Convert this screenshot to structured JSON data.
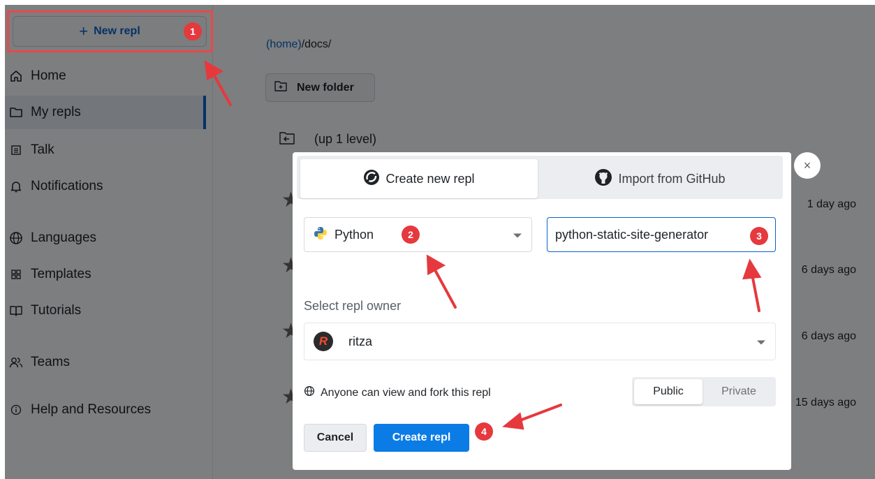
{
  "sidebar": {
    "new_repl": "New repl",
    "items": [
      {
        "label": "Home",
        "icon": "home-icon"
      },
      {
        "label": "My repls",
        "icon": "folder-icon"
      },
      {
        "label": "Talk",
        "icon": "talk-icon"
      },
      {
        "label": "Notifications",
        "icon": "bell-icon"
      },
      {
        "label": "Languages",
        "icon": "globe-icon"
      },
      {
        "label": "Templates",
        "icon": "templates-icon"
      },
      {
        "label": "Tutorials",
        "icon": "book-icon"
      },
      {
        "label": "Teams",
        "icon": "people-icon"
      },
      {
        "label": "Help and Resources",
        "icon": "info-icon"
      }
    ]
  },
  "main": {
    "breadcrumb_home": "(home)",
    "breadcrumb_path": "/docs/",
    "new_folder": "New folder",
    "up_level": "(up 1 level)",
    "rows": [
      {
        "time": "1 day ago"
      },
      {
        "time": "6 days ago"
      },
      {
        "time": "6 days ago"
      },
      {
        "time": "15 days ago"
      }
    ]
  },
  "modal": {
    "tab_create": "Create new repl",
    "tab_import": "Import from GitHub",
    "language": "Python",
    "repl_name": "python-static-site-generator",
    "owner_label": "Select repl owner",
    "owner_initial": "R",
    "owner_name": "ritza",
    "visibility_text": "Anyone can view and fork this repl",
    "public": "Public",
    "private": "Private",
    "cancel": "Cancel",
    "create": "Create repl",
    "close": "×"
  },
  "annotations": {
    "badges": [
      "1",
      "2",
      "3",
      "4"
    ],
    "color": "#e5393e"
  }
}
